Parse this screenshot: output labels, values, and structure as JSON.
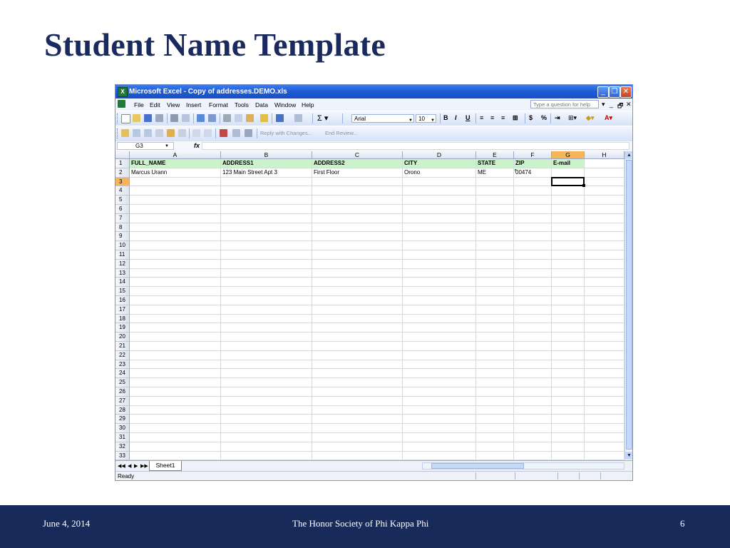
{
  "slide": {
    "title": "Student Name Template",
    "footer_date": "June 4, 2014",
    "footer_org": "The Honor Society of Phi Kappa Phi",
    "page_number": "6"
  },
  "excel": {
    "window_title": "Microsoft Excel - Copy of addresses.DEMO.xls",
    "menu": [
      "File",
      "Edit",
      "View",
      "Insert",
      "Format",
      "Tools",
      "Data",
      "Window",
      "Help"
    ],
    "help_placeholder": "Type a question for help",
    "font": "Arial",
    "font_size": "10",
    "reply_label": "Reply with Changes...",
    "end_review_label": "End Review...",
    "name_box": "G3",
    "fx": "fx",
    "columns": [
      "A",
      "B",
      "C",
      "D",
      "E",
      "F",
      "G",
      "H"
    ],
    "rows": [
      [
        "FULL_NAME",
        "ADDRESS1",
        "ADDRESS2",
        "CITY",
        "STATE",
        "ZIP",
        "E-mail",
        ""
      ],
      [
        "Marcus Urann",
        "123 Main Street Apt 3",
        "First Floor",
        "Orono",
        "ME",
        "00474",
        "",
        ""
      ]
    ],
    "row_numbers": [
      "1",
      "2",
      "3",
      "4",
      "5",
      "6",
      "7",
      "8",
      "9",
      "10",
      "11",
      "12",
      "13",
      "14",
      "15",
      "16",
      "17",
      "18",
      "19",
      "20",
      "21",
      "22",
      "23",
      "24",
      "25",
      "26",
      "27",
      "28",
      "29",
      "30",
      "31",
      "32",
      "33"
    ],
    "active_cell": "G3",
    "sheet_tab": "Sheet1",
    "status": "Ready",
    "colors": {
      "title_blue": "#1b2a5e",
      "footer_navy": "#172a5a",
      "header_row_green": "#ccf2cc",
      "selected_header": "#f7b55a"
    }
  }
}
